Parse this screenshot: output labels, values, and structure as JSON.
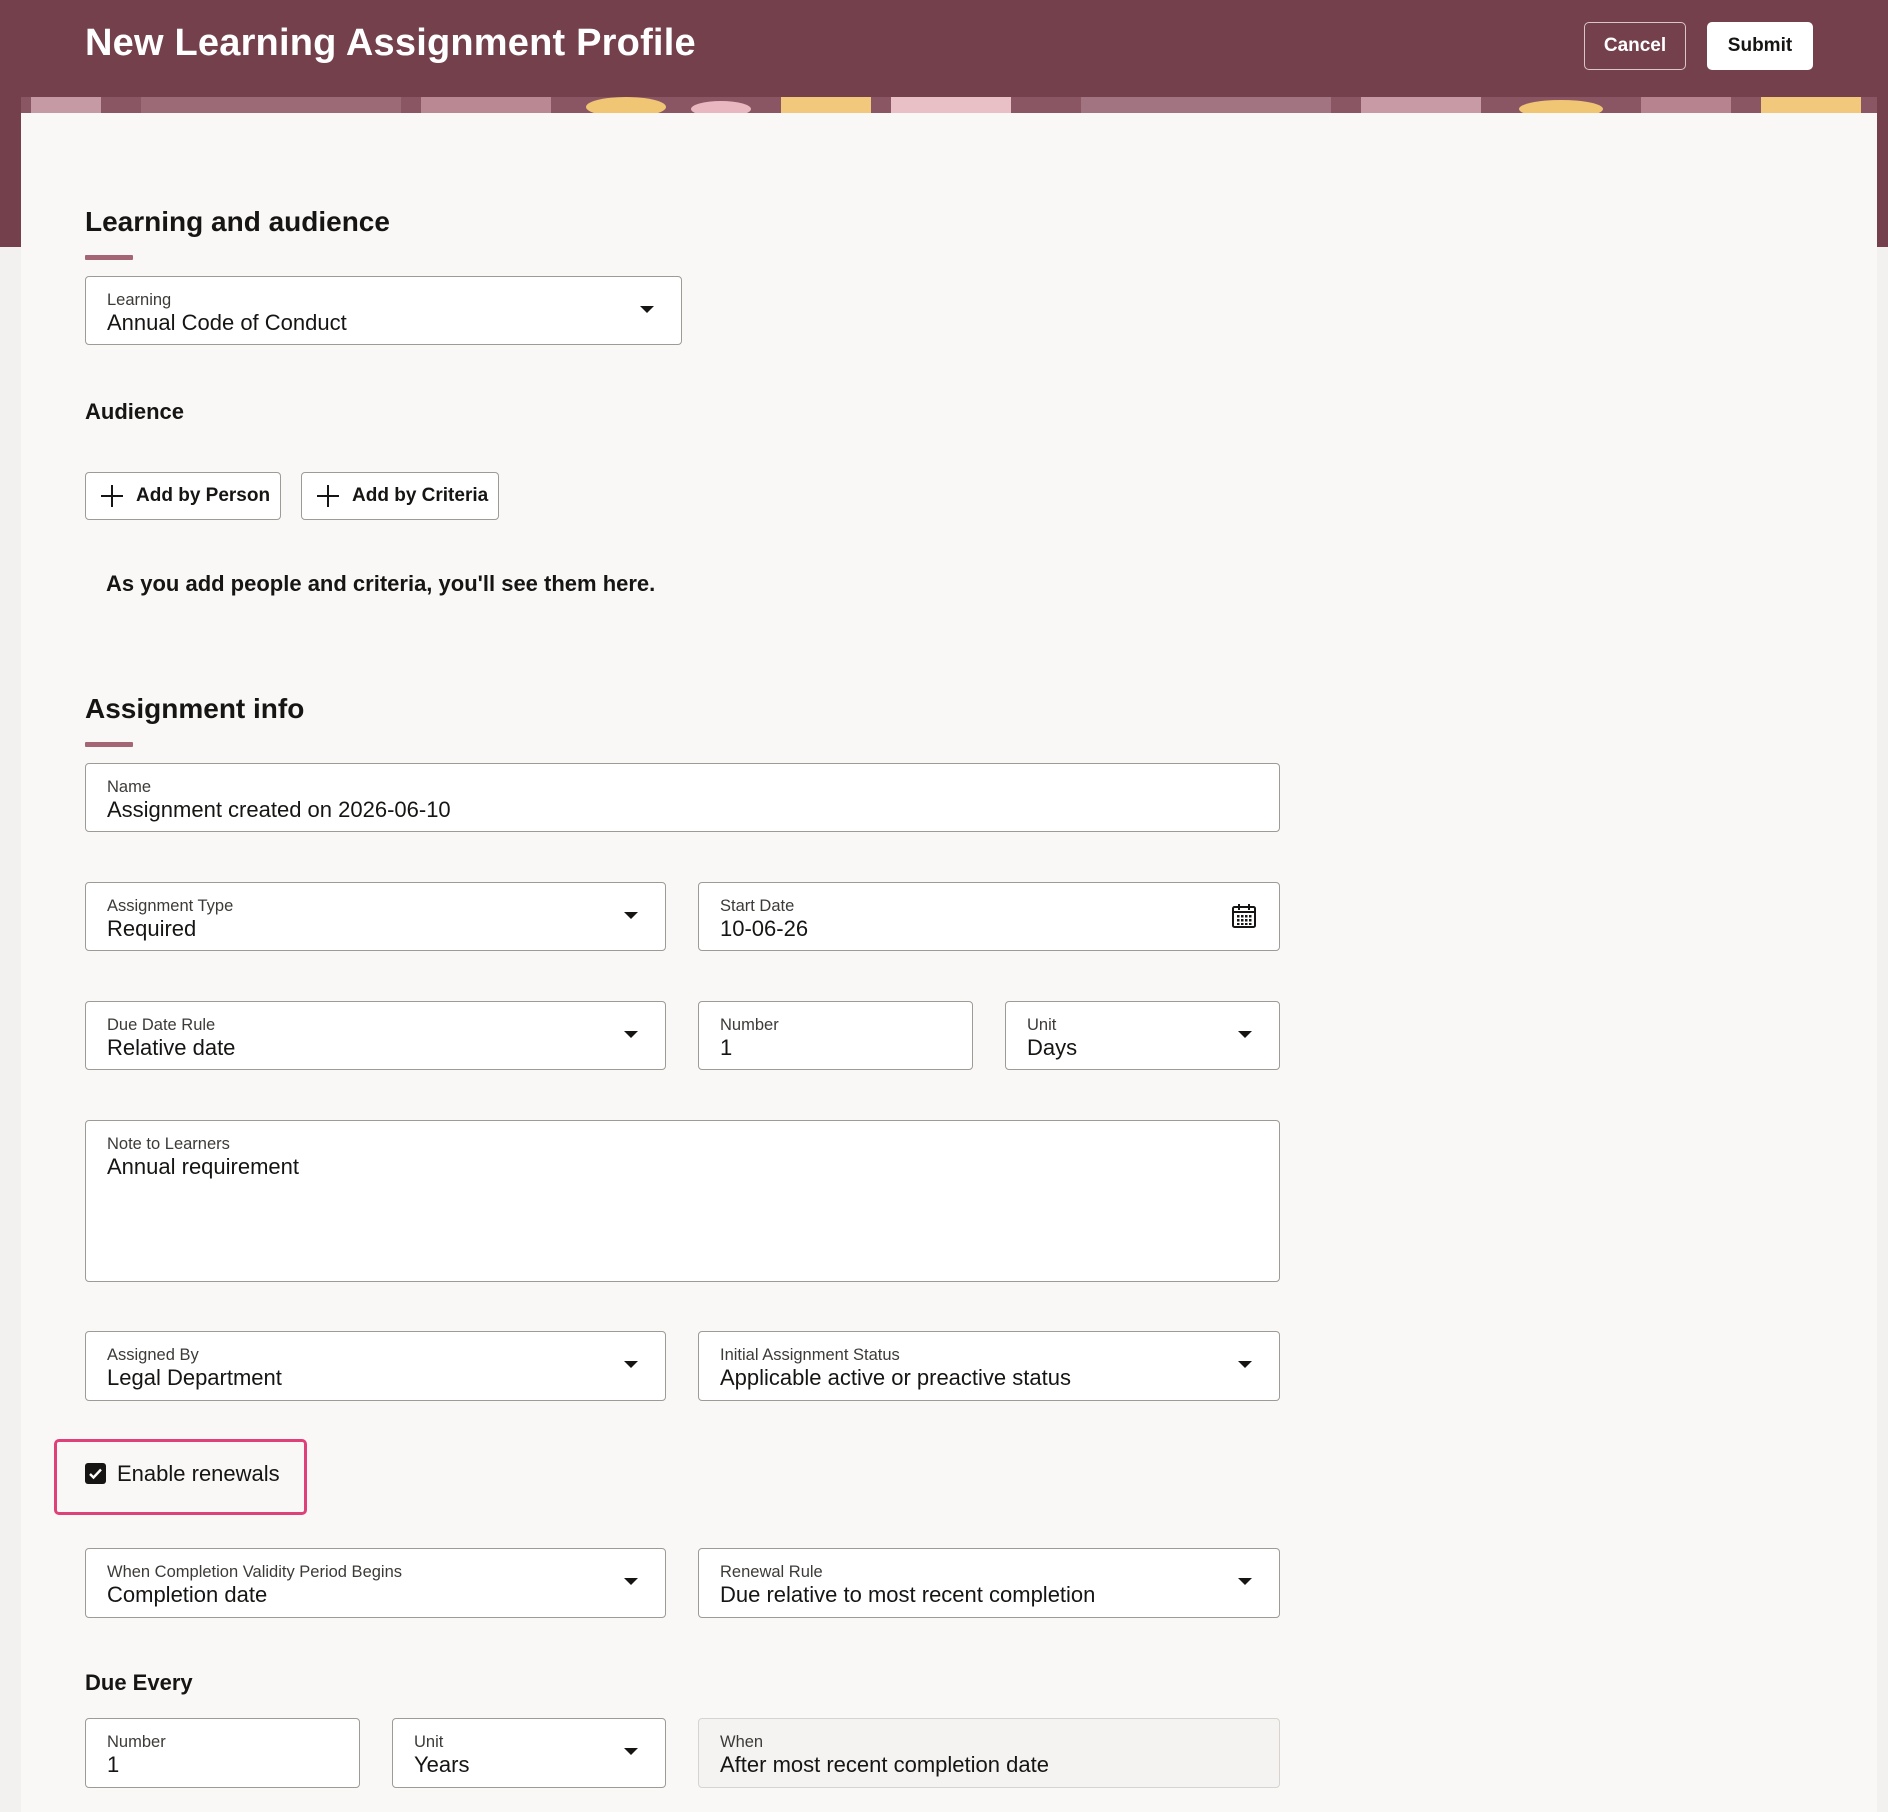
{
  "header": {
    "title": "New Learning Assignment Profile",
    "cancel_label": "Cancel",
    "submit_label": "Submit"
  },
  "learning_section": {
    "title": "Learning and audience",
    "learning": {
      "label": "Learning",
      "value": "Annual Code of Conduct"
    },
    "audience_title": "Audience",
    "add_by_person": "Add by Person",
    "add_by_criteria": "Add by Criteria",
    "empty_message": "As you add people and criteria, you'll see them here."
  },
  "assignment_section": {
    "title": "Assignment info",
    "name": {
      "label": "Name",
      "value": "Assignment created on 2026-06-10"
    },
    "assignment_type": {
      "label": "Assignment Type",
      "value": "Required"
    },
    "start_date": {
      "label": "Start Date",
      "value": "10-06-26"
    },
    "due_date_rule": {
      "label": "Due Date Rule",
      "value": "Relative date"
    },
    "number": {
      "label": "Number",
      "value": "1"
    },
    "unit": {
      "label": "Unit",
      "value": "Days"
    },
    "note": {
      "label": "Note to Learners",
      "value": "Annual requirement"
    },
    "assigned_by": {
      "label": "Assigned By",
      "value": "Legal Department"
    },
    "initial_status": {
      "label": "Initial Assignment Status",
      "value": "Applicable active or preactive status"
    },
    "enable_renewals": {
      "label": "Enable renewals",
      "checked": true
    },
    "validity_begins": {
      "label": "When Completion Validity Period Begins",
      "value": "Completion date"
    },
    "renewal_rule": {
      "label": "Renewal Rule",
      "value": "Due relative to most recent completion"
    },
    "due_every_title": "Due Every",
    "due_every_number": {
      "label": "Number",
      "value": "1"
    },
    "due_every_unit": {
      "label": "Unit",
      "value": "Years"
    },
    "due_every_when": {
      "label": "When",
      "value": "After most recent completion date"
    }
  },
  "colors": {
    "header_bg": "#73404c",
    "accent_bar": "#a46574",
    "highlight": "#e0407a"
  }
}
